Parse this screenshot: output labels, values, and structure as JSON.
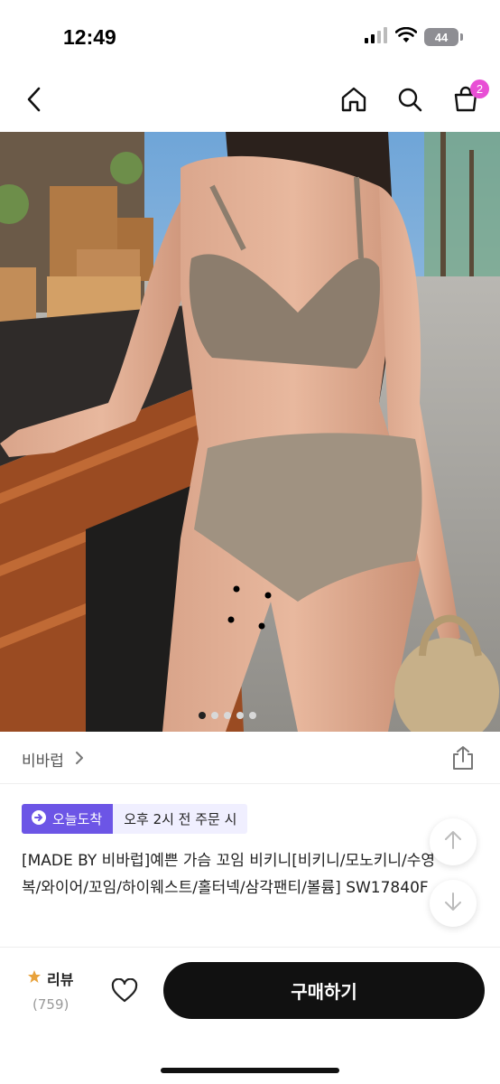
{
  "status_bar": {
    "time": "12:49",
    "battery": "44"
  },
  "nav": {
    "cart_count": "2"
  },
  "gallery": {
    "total_images": 5,
    "current_index": 1
  },
  "brand": {
    "name": "비바럽"
  },
  "delivery": {
    "badge": "오늘도착",
    "condition": "오후 2시 전 주문 시"
  },
  "product": {
    "title": "[MADE BY 비바럽]예쁜 가슴 꼬임 비키니[비키니/모노키니/수영복/와이어/꼬임/하이웨스트/홀터넥/삼각팬티/볼륨] SW17840F"
  },
  "bottom_bar": {
    "review_label": "리뷰",
    "review_count": "(759)",
    "buy_label": "구매하기"
  },
  "colors": {
    "accent_purple": "#6c55e6",
    "cart_badge": "#e84fd5",
    "buy_button": "#111111"
  },
  "icons": [
    "chevron-left-icon",
    "home-icon",
    "search-icon",
    "cart-icon",
    "share-icon",
    "arrow-up-icon",
    "arrow-down-icon",
    "star-icon",
    "heart-icon"
  ]
}
